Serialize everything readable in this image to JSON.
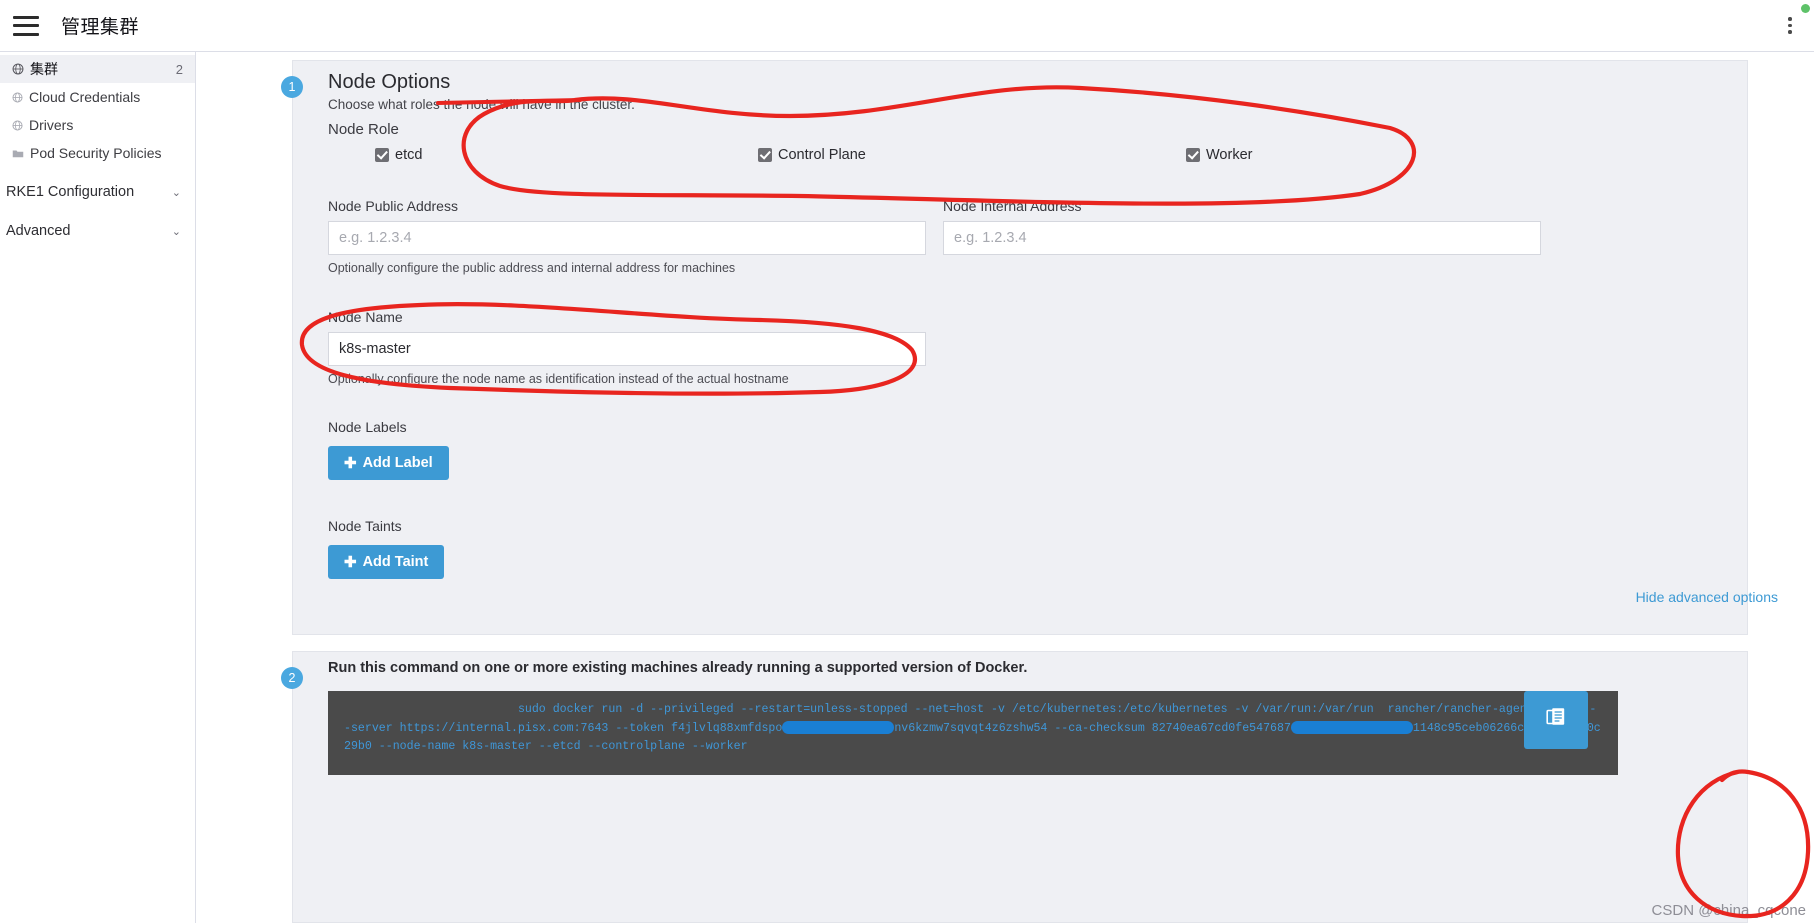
{
  "topbar": {
    "title": "管理集群",
    "menu_icon": "hamburger-icon",
    "overflow_icon": "kebab-menu-icon"
  },
  "sidebar": {
    "items": [
      {
        "label": "集群",
        "count": "2",
        "icon": "globe-icon",
        "active": true
      },
      {
        "label": "Cloud Credentials",
        "count": "",
        "icon": "globe-icon",
        "active": false
      },
      {
        "label": "Drivers",
        "count": "",
        "icon": "globe-icon",
        "active": false
      },
      {
        "label": "Pod Security Policies",
        "count": "",
        "icon": "folder-icon",
        "active": false
      }
    ],
    "groups": [
      {
        "label": "RKE1 Configuration",
        "chevron": "chevron-down-icon"
      },
      {
        "label": "Advanced",
        "chevron": "chevron-down-icon"
      }
    ]
  },
  "main": {
    "step1": {
      "badge": "1",
      "title": "Node Options",
      "subtitle": "Choose what roles the node will have in the cluster.",
      "node_role_label": "Node Role",
      "roles": [
        {
          "label": "etcd",
          "checked": true
        },
        {
          "label": "Control Plane",
          "checked": true
        },
        {
          "label": "Worker",
          "checked": true
        }
      ],
      "public_address": {
        "label": "Node Public Address",
        "value": "",
        "placeholder": "e.g. 1.2.3.4",
        "hint": "Optionally configure the public address and internal address for machines"
      },
      "internal_address": {
        "label": "Node Internal Address",
        "value": "",
        "placeholder": "e.g. 1.2.3.4",
        "hint": ""
      },
      "node_name": {
        "label": "Node Name",
        "value": "k8s-master",
        "placeholder": "",
        "hint": "Optionally configure the node name as identification instead of the actual hostname"
      },
      "node_labels": {
        "label": "Node Labels",
        "button": "Add Label",
        "button_icon": "plus-icon"
      },
      "node_taints": {
        "label": "Node Taints",
        "button": "Add Taint",
        "button_icon": "plus-icon"
      },
      "hide_advanced": "Hide advanced options"
    },
    "step2": {
      "badge": "2",
      "description": "Run this command on one or more existing machines already running a supported version of Docker.",
      "command_part1": "                         sudo docker run -d --privileged --restart=unless-stopped --net=host -v /etc/kubernetes:/etc/kubernetes -v /var/run:/var/run  rancher/rancher-agent:v2.6.3 --server https://internal.pisx.com:7643 --token f4jlvlq88xmfdspo",
      "command_part2": "nv6kzmw7sqvqt4z6zshw54 --ca-checksum 82740ea67cd0fe547687",
      "command_part3": "1148c95ceb06266c34ed979b80c29b0 --node-name k8s-master --etcd --controlplane --worker",
      "copy_icon": "clipboard-copy-icon"
    }
  },
  "watermark": "CSDN @china_cqcone",
  "colors": {
    "accent": "#3d9ad4",
    "badge": "#4aa8e0",
    "card_bg": "#eff0f4",
    "terminal_bg": "#4a4a4a",
    "terminal_text": "#3f97d8",
    "annotation": "#e8251f",
    "redaction": "#1a7fd4",
    "status_dot": "#5ec269"
  }
}
